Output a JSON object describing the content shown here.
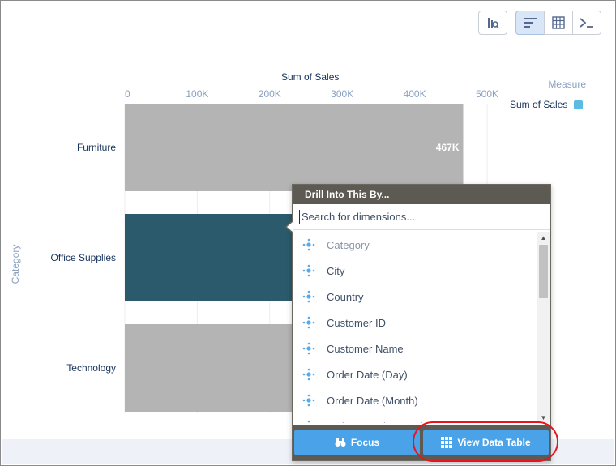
{
  "toolbar": {
    "buttons": [
      {
        "icon": "chart-settings-icon"
      },
      {
        "icon": "bar-chart-icon",
        "active": true
      },
      {
        "icon": "table-icon"
      },
      {
        "icon": "terminal-icon"
      }
    ]
  },
  "chart_data": {
    "type": "bar",
    "orientation": "horizontal",
    "xlabel": "Sum of Sales",
    "ylabel": "Category",
    "categories": [
      "Furniture",
      "Office Supplies",
      "Technology"
    ],
    "series": [
      {
        "name": "Sum of Sales",
        "values": [
          467000,
          475000,
          520000
        ]
      }
    ],
    "value_labels": [
      "467K",
      "",
      ""
    ],
    "x_ticks": [
      "0",
      "100K",
      "200K",
      "300K",
      "400K",
      "500K"
    ],
    "x_tick_values": [
      0,
      100000,
      200000,
      300000,
      400000,
      500000
    ],
    "xlim": [
      0,
      500000
    ],
    "grid": true,
    "selected_category": "Office Supplies",
    "colors": {
      "bar": "#b4b4b4",
      "selected": "#2a5a6b",
      "legend": "#5bbbe3"
    },
    "legend": {
      "title": "Measure",
      "entries": [
        "Sum of Sales"
      ],
      "position": "top-right"
    }
  },
  "popover": {
    "title": "Drill Into This By...",
    "search_placeholder": "Search for dimensions...",
    "items": [
      "Category",
      "City",
      "Country",
      "Customer ID",
      "Customer Name",
      "Order Date (Day)",
      "Order Date (Month)",
      "Order Date (Quarter)"
    ],
    "focus_label": "Focus",
    "view_table_label": "View Data Table",
    "highlight_color": "#e8131b"
  }
}
